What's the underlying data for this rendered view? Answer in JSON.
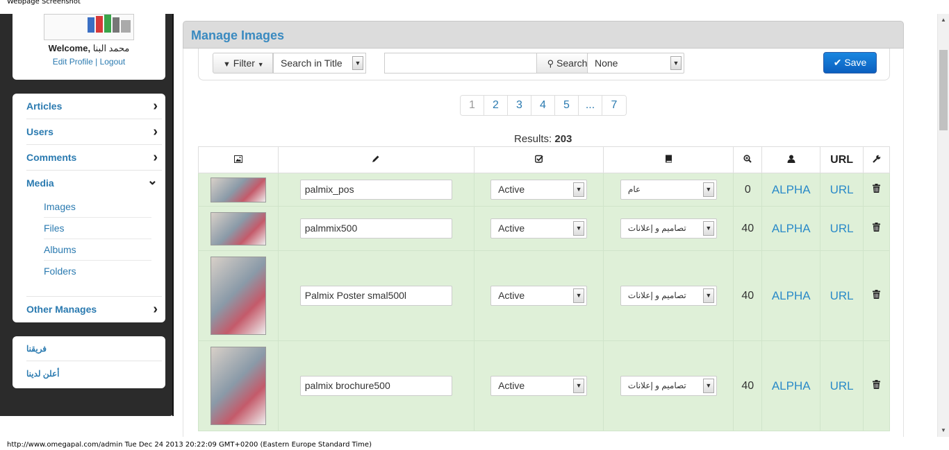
{
  "window": {
    "caption": "Webpage Screenshot"
  },
  "status_bar": {
    "text": "http://www.omegapal.com/admin Tue Dec 24 2013 20:22:09 GMT+0200 (Eastern Europe Standard Time)"
  },
  "profile": {
    "welcome_label": "Welcome,",
    "user_name": "محمد البنا",
    "edit_profile": "Edit Profile",
    "separator": "|",
    "logout": "Logout"
  },
  "sidebar": {
    "items": [
      {
        "label": "Articles",
        "icon": "chevron-right-icon",
        "glyph": "›"
      },
      {
        "label": "Users",
        "icon": "chevron-right-icon",
        "glyph": "›"
      },
      {
        "label": "Comments",
        "icon": "chevron-right-icon",
        "glyph": "›"
      },
      {
        "label": "Media",
        "icon": "chevron-down-icon",
        "glyph": "⌄"
      },
      {
        "label": "Other Manages",
        "icon": "chevron-right-icon",
        "glyph": "›"
      }
    ],
    "media_sub": [
      "Images",
      "Files",
      "Albums",
      "Folders"
    ],
    "extra_links": [
      "فريقنا",
      "أعلن لدينا"
    ]
  },
  "header": {
    "title": "Manage Images"
  },
  "toolbar": {
    "filter_label": "Filter",
    "search_field": "Search in Title",
    "search_value": "",
    "search_button": "Search",
    "category_value": "None",
    "save_label": "Save"
  },
  "pagination": {
    "pages": [
      "1",
      "2",
      "3",
      "4",
      "5",
      "...",
      "7"
    ],
    "current": "1"
  },
  "results": {
    "label": "Results:",
    "count": "203"
  },
  "table": {
    "columns": [
      {
        "icon": "image-icon",
        "glyph": "▣",
        "label": ""
      },
      {
        "icon": "pencil-icon",
        "glyph": "✎",
        "label": ""
      },
      {
        "icon": "check-square-icon",
        "glyph": "☑",
        "label": ""
      },
      {
        "icon": "book-icon",
        "glyph": "▮",
        "label": ""
      },
      {
        "icon": "zoom-icon",
        "glyph": "⊕",
        "label": ""
      },
      {
        "icon": "user-icon",
        "glyph": "☗",
        "label": ""
      },
      {
        "icon": "",
        "glyph": "",
        "label": "URL"
      },
      {
        "icon": "wrench-icon",
        "glyph": "✁",
        "label": ""
      }
    ],
    "rows": [
      {
        "title": "palmix_pos",
        "status": "Active",
        "category": "عام",
        "views": "0",
        "author": "ALPHA",
        "url": "URL",
        "thumb_h": 36
      },
      {
        "title": "palmmix500",
        "status": "Active",
        "category": "تصاميم و إعلانات",
        "views": "40",
        "author": "ALPHA",
        "url": "URL",
        "thumb_h": 48
      },
      {
        "title": "Palmix Poster smal500l",
        "status": "Active",
        "category": "تصاميم و إعلانات",
        "views": "40",
        "author": "ALPHA",
        "url": "URL",
        "thumb_h": 113
      },
      {
        "title": "palmix brochure500",
        "status": "Active",
        "category": "تصاميم و إعلانات",
        "views": "40",
        "author": "ALPHA",
        "url": "URL",
        "thumb_h": 113
      }
    ]
  },
  "colors": {
    "accent": "#2a7ab0",
    "row_bg": "#dff0d8",
    "save_button": "#0b5fbf",
    "sidebar_bg": "#2b2b2b"
  }
}
